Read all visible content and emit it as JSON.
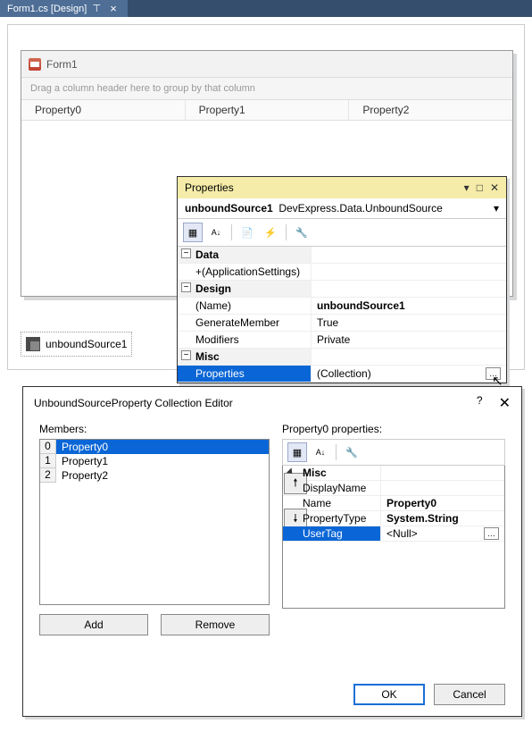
{
  "tab": {
    "label": "Form1.cs [Design]"
  },
  "form": {
    "title": "Form1",
    "group_hint": "Drag a column header here to group by that column",
    "columns": [
      "Property0",
      "Property1",
      "Property2"
    ]
  },
  "component": {
    "name": "unboundSource1"
  },
  "properties_panel": {
    "title": "Properties",
    "object_name": "unboundSource1",
    "object_type": "DevExpress.Data.UnboundSource",
    "categories": [
      {
        "name": "Data",
        "expanded": true,
        "rows": [
          {
            "key": "(ApplicationSettings)",
            "val": "",
            "expandable": true
          }
        ]
      },
      {
        "name": "Design",
        "expanded": true,
        "rows": [
          {
            "key": "(Name)",
            "val": "unboundSource1",
            "bold": true
          },
          {
            "key": "GenerateMember",
            "val": "True"
          },
          {
            "key": "Modifiers",
            "val": "Private"
          }
        ]
      },
      {
        "name": "Misc",
        "expanded": true,
        "rows": [
          {
            "key": "Properties",
            "val": "(Collection)",
            "selected": true,
            "ellipsis": true
          }
        ]
      }
    ]
  },
  "collection_editor": {
    "title": "UnboundSourceProperty Collection Editor",
    "members_label": "Members:",
    "right_label": "Property0 properties:",
    "members": [
      {
        "idx": "0",
        "name": "Property0",
        "selected": true
      },
      {
        "idx": "1",
        "name": "Property1"
      },
      {
        "idx": "2",
        "name": "Property2"
      }
    ],
    "add_label": "Add",
    "remove_label": "Remove",
    "right_grid": {
      "category": "Misc",
      "rows": [
        {
          "key": "DisplayName",
          "val": ""
        },
        {
          "key": "Name",
          "val": "Property0",
          "bold": true
        },
        {
          "key": "PropertyType",
          "val": "System.String",
          "bold": true
        },
        {
          "key": "UserTag",
          "val": "<Null>",
          "selected": true,
          "ellipsis": true
        }
      ]
    },
    "ok_label": "OK",
    "cancel_label": "Cancel"
  }
}
